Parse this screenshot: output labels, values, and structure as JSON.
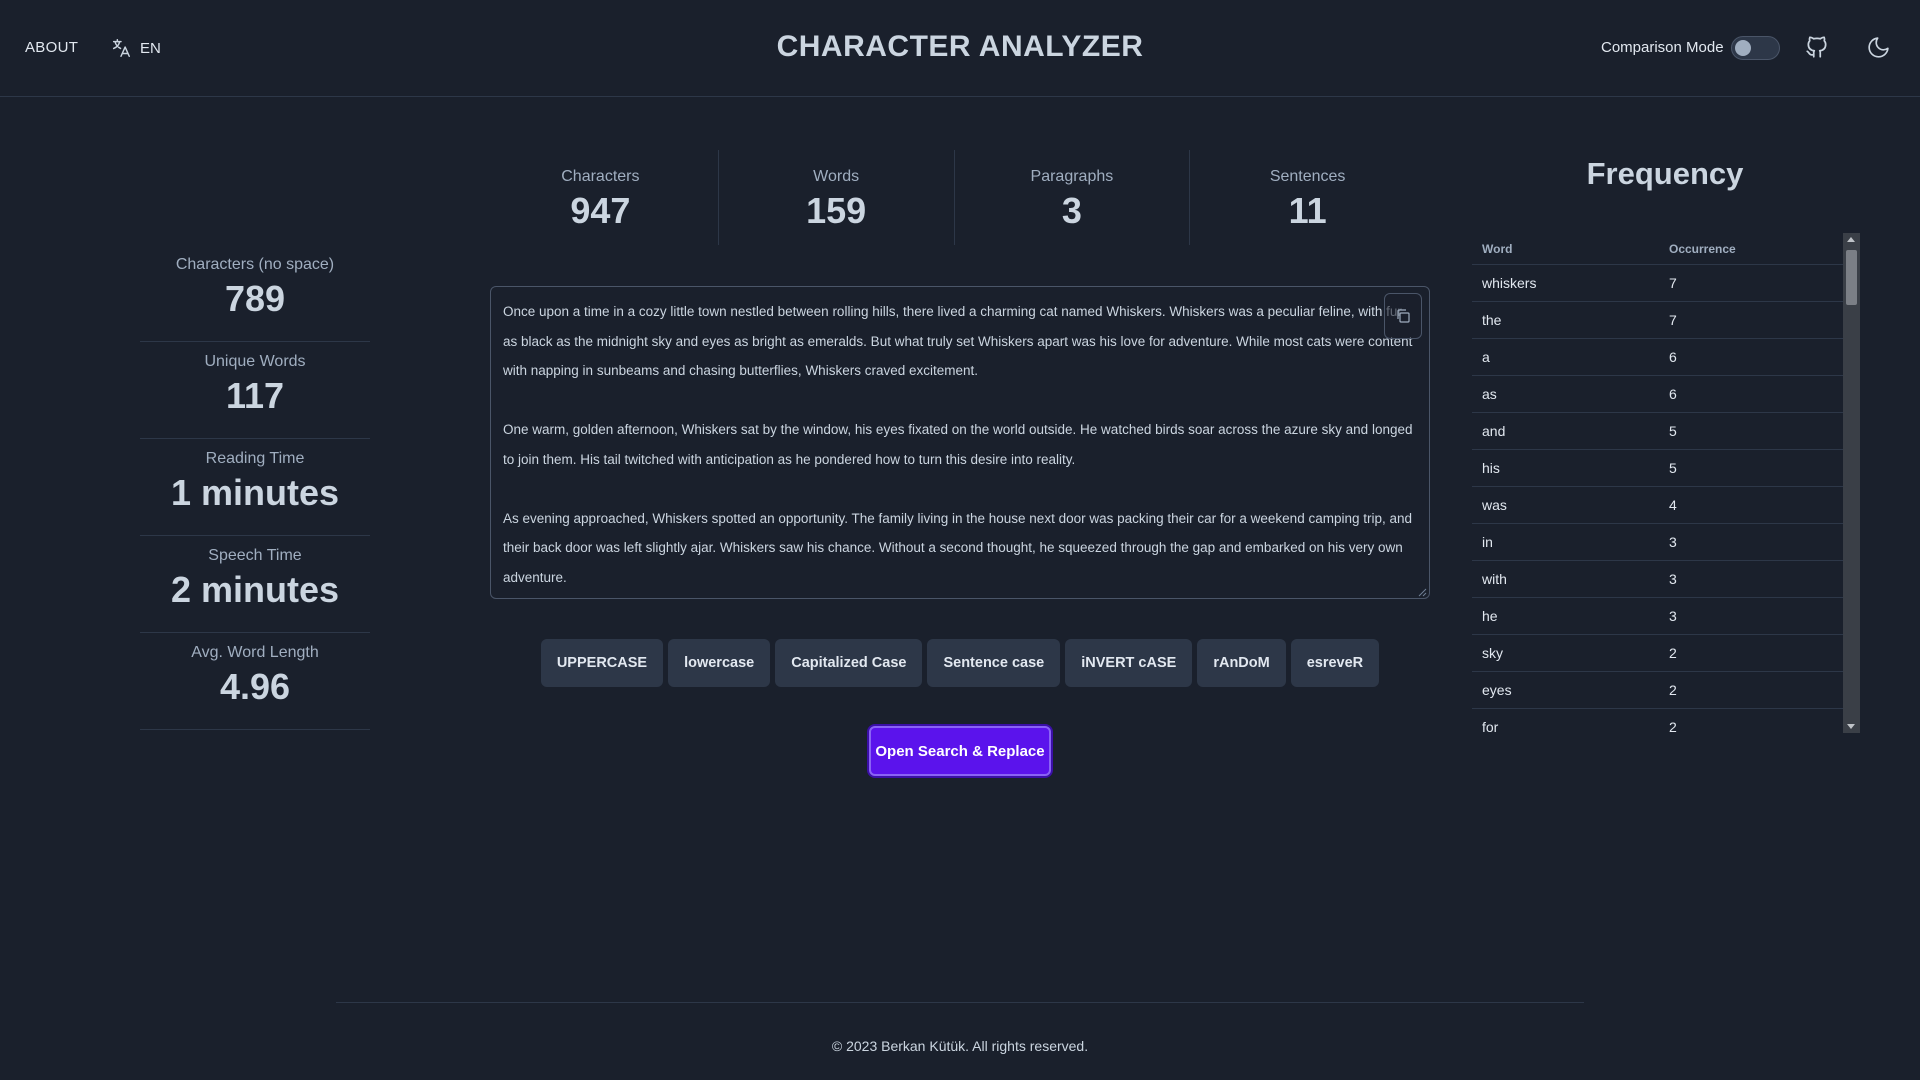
{
  "header": {
    "about": "ABOUT",
    "language": "EN",
    "title": "CHARACTER ANALYZER",
    "comparison_mode": "Comparison Mode"
  },
  "top_stats": [
    {
      "label": "Characters",
      "value": "947"
    },
    {
      "label": "Words",
      "value": "159"
    },
    {
      "label": "Paragraphs",
      "value": "3"
    },
    {
      "label": "Sentences",
      "value": "11"
    }
  ],
  "left_stats": [
    {
      "label": "Characters (no space)",
      "value": "789"
    },
    {
      "label": "Unique Words",
      "value": "117"
    },
    {
      "label": "Reading Time",
      "value": "1 minutes"
    },
    {
      "label": "Speech Time",
      "value": "2 minutes"
    },
    {
      "label": "Avg. Word Length",
      "value": "4.96"
    }
  ],
  "editor": {
    "paragraphs": [
      "Once upon a time in a cozy little town nestled between rolling hills, there lived a charming cat named Whiskers. Whiskers was a peculiar feline, with fur as black as the midnight sky and eyes as bright as emeralds. But what truly set Whiskers apart was his love for adventure. While most cats were content with napping in sunbeams and chasing butterflies, Whiskers craved excitement.",
      "One warm, golden afternoon, Whiskers sat by the window, his eyes fixated on the world outside. He watched birds soar across the azure sky and longed to join them. His tail twitched with anticipation as he pondered how to turn this desire into reality.",
      "As evening approached, Whiskers spotted an opportunity. The family living in the house next door was packing their car for a weekend camping trip, and their back door was left slightly ajar. Whiskers saw his chance. Without a second thought, he squeezed through the gap and embarked on his very own adventure."
    ]
  },
  "case_buttons": {
    "upper": "UPPERCASE",
    "lower": "lowercase",
    "capitalized": "Capitalized Case",
    "sentence": "Sentence case",
    "invert": "iNVERT cASE",
    "random": "rAnDoM",
    "reverse": "esreveR"
  },
  "search_replace": "Open Search & Replace",
  "frequency": {
    "title": "Frequency",
    "col_word": "Word",
    "col_occurrence": "Occurrence",
    "rows": [
      {
        "word": "whiskers",
        "count": "7"
      },
      {
        "word": "the",
        "count": "7"
      },
      {
        "word": "a",
        "count": "6"
      },
      {
        "word": "as",
        "count": "6"
      },
      {
        "word": "and",
        "count": "5"
      },
      {
        "word": "his",
        "count": "5"
      },
      {
        "word": "was",
        "count": "4"
      },
      {
        "word": "in",
        "count": "3"
      },
      {
        "word": "with",
        "count": "3"
      },
      {
        "word": "he",
        "count": "3"
      },
      {
        "word": "sky",
        "count": "2"
      },
      {
        "word": "eyes",
        "count": "2"
      },
      {
        "word": "for",
        "count": "2"
      }
    ]
  },
  "footer": "© 2023 Berkan Kütük. All rights reserved.",
  "colors": {
    "background": "#1a202c",
    "accent": "#5b13ec"
  }
}
